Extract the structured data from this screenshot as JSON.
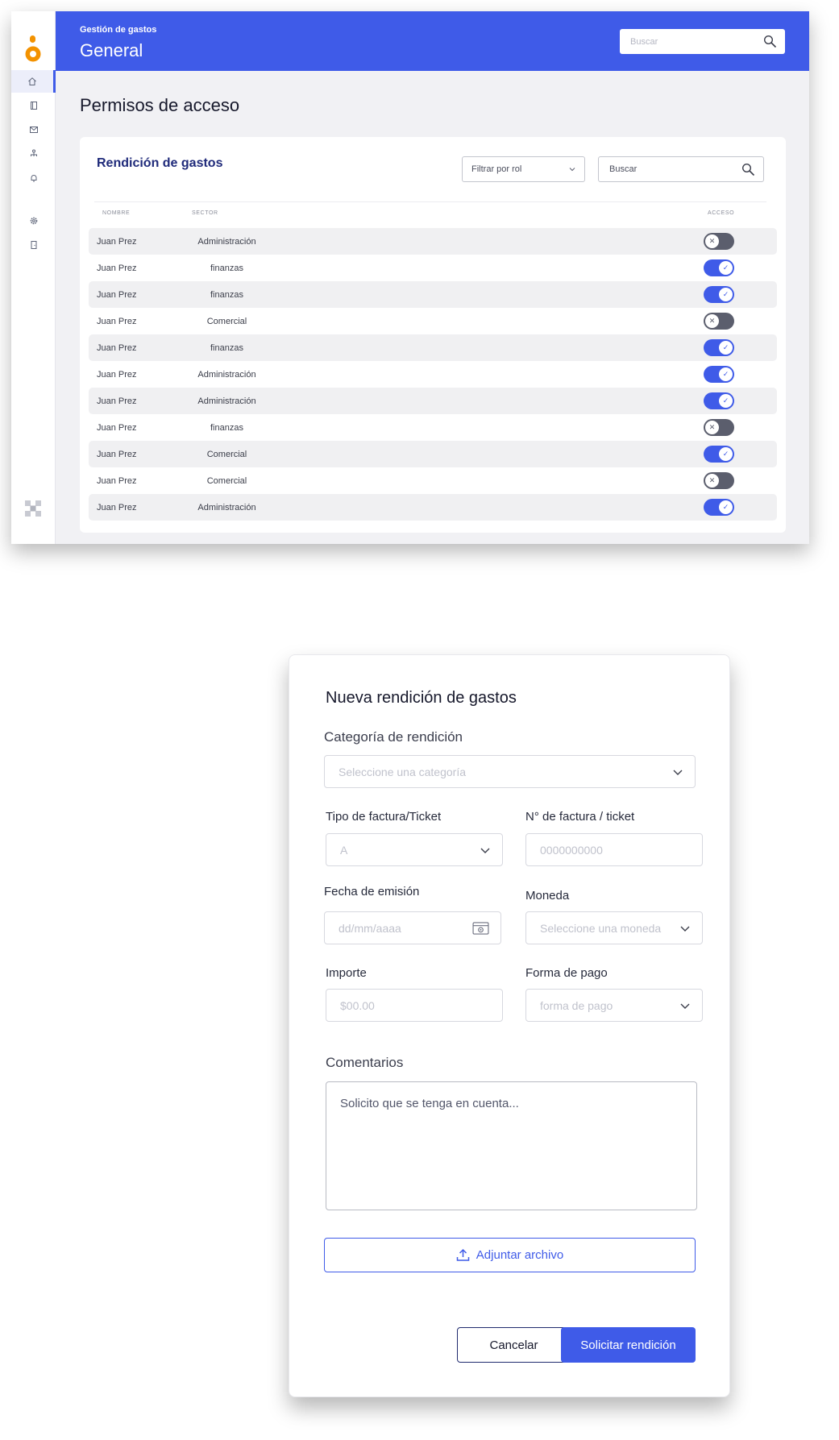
{
  "dashboard": {
    "header": {
      "breadcrumb": "Gestión de gastos",
      "title": "General",
      "search_placeholder": "Buscar"
    },
    "sidebar": {
      "items": [
        {
          "icon": "home-icon",
          "active": true
        },
        {
          "icon": "book-icon",
          "active": false
        },
        {
          "icon": "mail-icon",
          "active": false
        },
        {
          "icon": "org-chart-icon",
          "active": false
        },
        {
          "icon": "bell-icon",
          "active": false
        },
        {
          "icon": "gear-icon",
          "active": false
        },
        {
          "icon": "logout-door-icon",
          "active": false
        }
      ]
    },
    "page_title": "Permisos de acceso",
    "card": {
      "title": "Rendición de gastos",
      "filter_label": "Filtrar por rol",
      "search_placeholder": "Buscar",
      "columns": {
        "name": "NOMBRE",
        "sector": "SECTOR",
        "access": "ACCESO"
      },
      "rows": [
        {
          "name": "Juan Prez",
          "sector": "Administración",
          "access": false
        },
        {
          "name": "Juan Prez",
          "sector": "finanzas",
          "access": true
        },
        {
          "name": "Juan Prez",
          "sector": "finanzas",
          "access": true
        },
        {
          "name": "Juan Prez",
          "sector": "Comercial",
          "access": false
        },
        {
          "name": "Juan Prez",
          "sector": "finanzas",
          "access": true
        },
        {
          "name": "Juan Prez",
          "sector": "Administración",
          "access": true
        },
        {
          "name": "Juan Prez",
          "sector": "Administración",
          "access": true
        },
        {
          "name": "Juan Prez",
          "sector": "finanzas",
          "access": false
        },
        {
          "name": "Juan Prez",
          "sector": "Comercial",
          "access": true
        },
        {
          "name": "Juan Prez",
          "sector": "Comercial",
          "access": false
        },
        {
          "name": "Juan Prez",
          "sector": "Administración",
          "access": true
        }
      ]
    },
    "colors": {
      "accent": "#3f5be8",
      "toggle_off": "#5b5e6d",
      "logo": "#f39200"
    }
  },
  "modal": {
    "title": "Nueva rendición de gastos",
    "category": {
      "label": "Categoría de rendición",
      "placeholder": "Seleccione una categoría"
    },
    "invoice_type": {
      "label": "Tipo de factura/Ticket",
      "value": "A"
    },
    "invoice_number": {
      "label": "N° de factura / ticket",
      "placeholder": "0000000000"
    },
    "issue_date": {
      "label": "Fecha de emisión",
      "placeholder": "dd/mm/aaaa"
    },
    "currency": {
      "label": "Moneda",
      "placeholder": "Seleccione una moneda"
    },
    "amount": {
      "label": "Importe",
      "placeholder": "$00.00"
    },
    "payment_method": {
      "label": "Forma de pago",
      "placeholder": "forma de pago"
    },
    "comments": {
      "label": "Comentarios",
      "placeholder": "Solicito que se tenga en cuenta..."
    },
    "attach_label": "Adjuntar archivo",
    "cancel_label": "Cancelar",
    "submit_label": "Solicitar rendición"
  }
}
